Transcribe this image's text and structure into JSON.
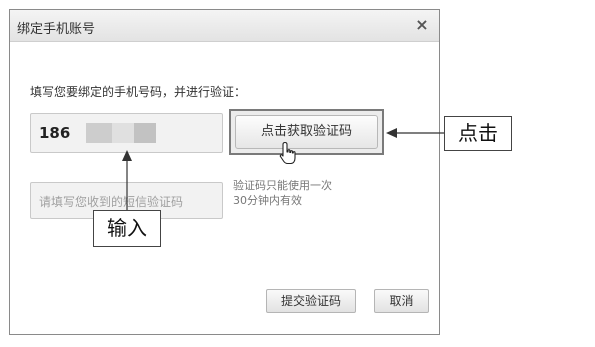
{
  "dialog": {
    "title": "绑定手机账号",
    "close_symbol": "×",
    "instruction": "填写您要绑定的手机号码，并进行验证：",
    "phone_prefix": "186",
    "code_placeholder": "请填写您收到的短信验证码",
    "get_code_label": "点击获取验证码",
    "note_line1": "验证码只能使用一次",
    "note_line2": "30分钟内有效",
    "submit_label": "提交验证码",
    "cancel_label": "取消"
  },
  "annotations": {
    "click_label": "点击",
    "input_label": "输入"
  },
  "icons": {
    "cursor": "hand-pointer-icon",
    "close": "close-icon"
  }
}
